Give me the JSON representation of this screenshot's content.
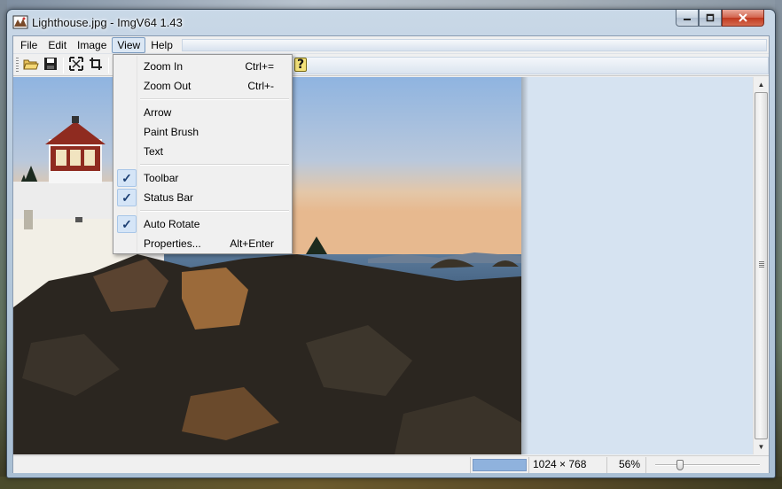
{
  "window": {
    "title": "Lighthouse.jpg - ImgV64 1.43"
  },
  "menubar": {
    "items": [
      "File",
      "Edit",
      "Image",
      "View",
      "Help"
    ],
    "active": "View"
  },
  "toolbar": {
    "buttons": [
      "open-folder-icon",
      "save-icon",
      "fit-icon",
      "crop-icon",
      "help-icon"
    ]
  },
  "view_menu": {
    "zoom_in": {
      "label": "Zoom In",
      "shortcut": "Ctrl+="
    },
    "zoom_out": {
      "label": "Zoom Out",
      "shortcut": "Ctrl+-"
    },
    "arrow": {
      "label": "Arrow"
    },
    "paint_brush": {
      "label": "Paint Brush"
    },
    "text": {
      "label": "Text"
    },
    "toolbar": {
      "label": "Toolbar",
      "checked": true
    },
    "status_bar": {
      "label": "Status Bar",
      "checked": true
    },
    "auto_rotate": {
      "label": "Auto Rotate",
      "checked": true
    },
    "properties": {
      "label": "Properties...",
      "shortcut": "Alt+Enter"
    }
  },
  "statusbar": {
    "dimensions": "1024 × 768",
    "zoom": "56%",
    "zoom_fraction": 0.56
  },
  "colors": {
    "accent": "#8fb2dd",
    "canvas_bg": "#d6e3f1",
    "check_bg": "#d5e5f7"
  }
}
